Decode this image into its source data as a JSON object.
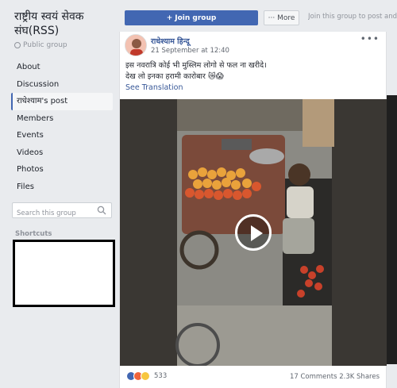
{
  "group": {
    "title": "राष्ट्रीय स्वयं सेवक संघ(RSS)",
    "privacy": "Public group"
  },
  "nav": {
    "items": [
      {
        "label": "About"
      },
      {
        "label": "Discussion"
      },
      {
        "label": "राधेश्याम's post"
      },
      {
        "label": "Members"
      },
      {
        "label": "Events"
      },
      {
        "label": "Videos"
      },
      {
        "label": "Photos"
      },
      {
        "label": "Files"
      }
    ],
    "active_index": 2
  },
  "search": {
    "placeholder": "Search this group"
  },
  "shortcuts": {
    "label": "Shortcuts"
  },
  "topbar": {
    "join_label": "Join group",
    "more_label": "More",
    "join_hint": "Join this group to post and com"
  },
  "post": {
    "author": "राधेश्याम हिन्दू",
    "time": "21 September at 12:40",
    "text_line1": "इस नवरात्रि कोई भी मुस्लिम लोगो से फल ना खरीदे।",
    "text_line2": "देख लो इनका हरामी कारोबार 😿😱",
    "see_translation": "See Translation",
    "reaction_count": "533",
    "stats": "17 Comments  2.3K Shares"
  },
  "colors": {
    "accent": "#4267b2",
    "link": "#385898",
    "background": "#e9ebee"
  }
}
